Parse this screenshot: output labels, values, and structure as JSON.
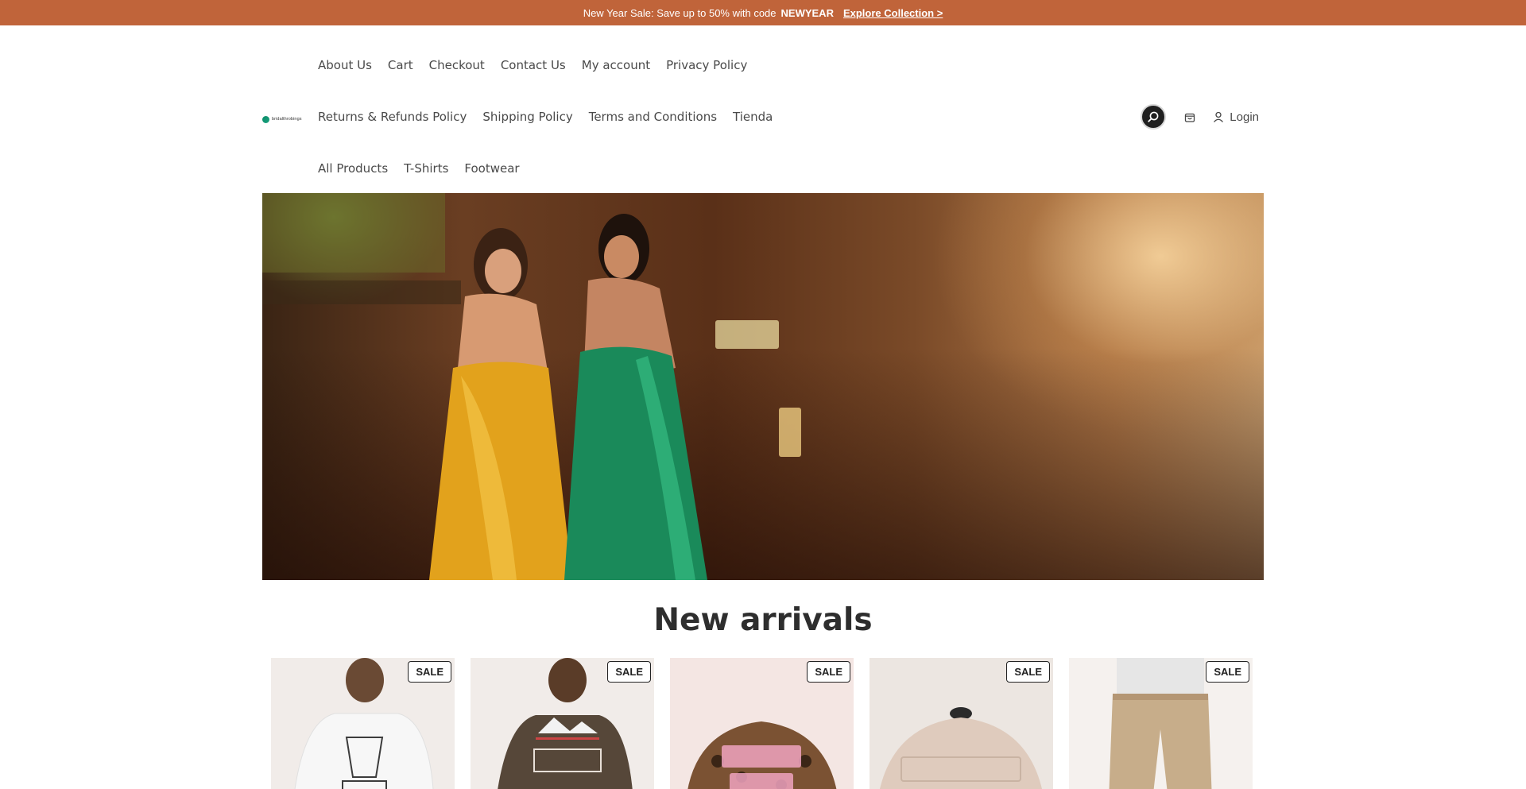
{
  "announcement": {
    "text": "New Year Sale: Save up to 50% with code",
    "code": "NEWYEAR",
    "link_label": "Explore Collection >"
  },
  "header": {
    "logo_text": "bridalthrobings",
    "nav_row1": [
      "About Us",
      "Cart",
      "Checkout",
      "Contact Us",
      "My account",
      "Privacy Policy"
    ],
    "nav_row2": [
      "Returns & Refunds Policy",
      "Shipping Policy",
      "Terms and Conditions",
      "Tienda"
    ],
    "nav_row3": [
      "All Products",
      "T-Shirts",
      "Footwear"
    ],
    "login_label": "Login"
  },
  "section": {
    "title": "New arrivals"
  },
  "products": [
    {
      "badge": "SALE",
      "icon": "white-graphic-tee"
    },
    {
      "badge": "SALE",
      "icon": "brown-graphic-tee"
    },
    {
      "badge": "SALE",
      "icon": "leopard-lover-girl-cap"
    },
    {
      "badge": "SALE",
      "icon": "beige-cap"
    },
    {
      "badge": "SALE",
      "icon": "khaki-jeans"
    }
  ],
  "colors": {
    "announcement_bg": "#c0643a",
    "search_button_bg": "#1f1f1f"
  }
}
